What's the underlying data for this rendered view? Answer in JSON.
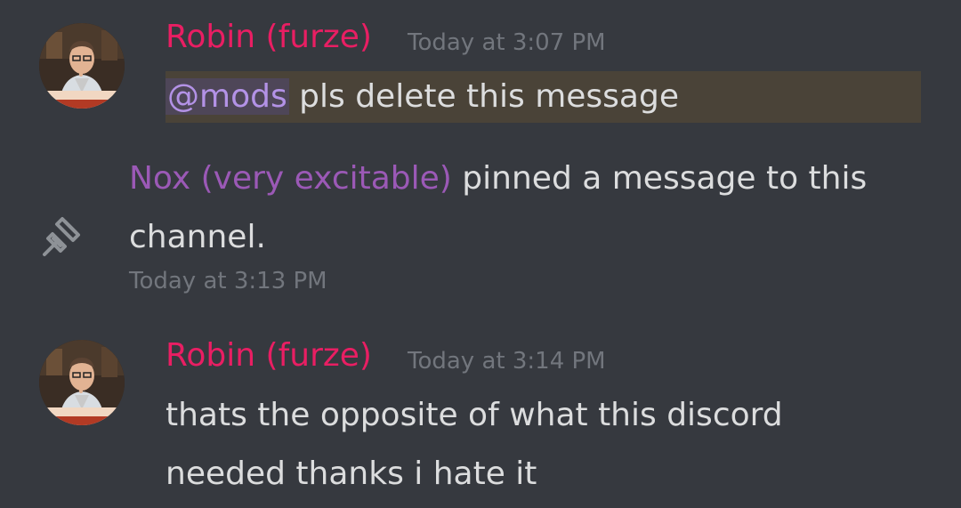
{
  "colors": {
    "background": "#36393f",
    "robin_name": "#e91e63",
    "nox_name": "#9b59b6",
    "mention_highlight": "#4a4338",
    "text": "#dcddde",
    "timestamp": "#72767d"
  },
  "messages": [
    {
      "author": "Robin (furze)",
      "timestamp": "Today at 3:07 PM",
      "mention": "@mods",
      "text": " pls delete this message"
    },
    {
      "type": "system-pin",
      "icon": "pin-icon",
      "actor": "Nox (very excitable)",
      "text_line1": " pinned a message to this",
      "text_line2": "channel.",
      "timestamp": "Today at 3:13 PM"
    },
    {
      "author": "Robin (furze)",
      "timestamp": "Today at 3:14 PM",
      "line1": "thats the opposite of what this discord",
      "line2": "needed thanks i hate it"
    }
  ]
}
